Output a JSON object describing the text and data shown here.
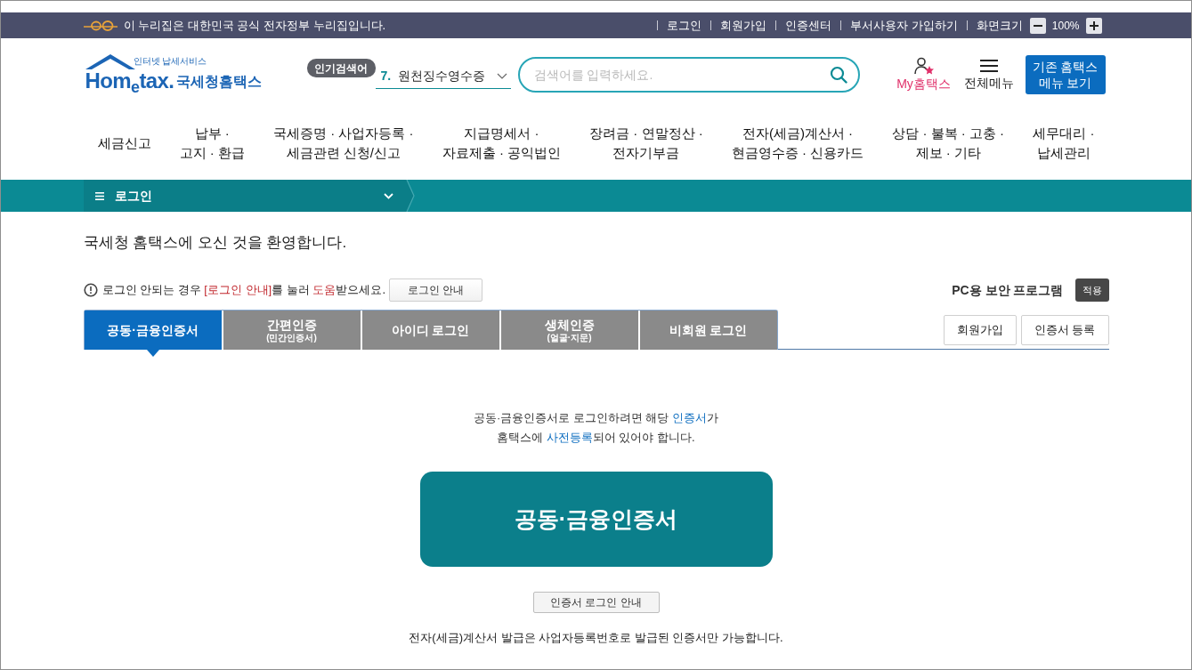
{
  "top_bar": {
    "notice": "이 누리집은 대한민국 공식 전자정부 누리집입니다.",
    "links": [
      "로그인",
      "회원가입",
      "인증센터",
      "부서사용자 가입하기"
    ],
    "zoom_label": "화면크기",
    "zoom_value": "100%"
  },
  "header": {
    "logo": {
      "tagline": "인터넷 납세서비스",
      "wordmark": "Hom$_{e}$tax.",
      "name": "국세청홈택스"
    },
    "popular_search": {
      "badge": "인기검색어",
      "rank": "7.",
      "term": "원천징수영수증"
    },
    "search": {
      "placeholder": "검색어를 입력하세요."
    },
    "my_hometax": "My홈택스",
    "all_menu": "전체메뉴",
    "classic_menu_button": [
      "기존 홈택스",
      "메뉴 보기"
    ]
  },
  "nav": [
    {
      "lines": [
        "세금신고"
      ]
    },
    {
      "lines": [
        "납부 ·",
        "고지 · 환급"
      ]
    },
    {
      "lines": [
        "국세증명 · 사업자등록 ·",
        "세금관련 신청/신고"
      ]
    },
    {
      "lines": [
        "지급명세서 ·",
        "자료제출 · 공익법인"
      ]
    },
    {
      "lines": [
        "장려금 · 연말정산 ·",
        "전자기부금"
      ]
    },
    {
      "lines": [
        "전자(세금)계산서 ·",
        "현금영수증 · 신용카드"
      ]
    },
    {
      "lines": [
        "상담 · 불복 · 고충 ·",
        "제보 · 기타"
      ]
    },
    {
      "lines": [
        "세무대리 ·",
        "납세관리"
      ]
    }
  ],
  "location_bar": {
    "current": "로그인"
  },
  "login": {
    "welcome": "국세청 홈택스에 오신 것을 환영합니다.",
    "help": [
      {
        "text": "로그인 안되는 경우 ",
        "emphasis": false
      },
      {
        "text": "[로그인 안내]",
        "emphasis": true
      },
      {
        "text": "를 눌러 ",
        "emphasis": false
      },
      {
        "text": "도움",
        "emphasis": true
      },
      {
        "text": "받으세요.",
        "emphasis": false
      }
    ],
    "help_button": "로그인 안내",
    "security_label": "PC용 보안 프로그램",
    "security_button": "적용",
    "tabs": [
      {
        "label": "공동·금융인증서",
        "selected": true
      },
      {
        "label": "간편인증",
        "sublabel": "(민간인증서)",
        "selected": false
      },
      {
        "label": "아이디 로그인",
        "selected": false
      },
      {
        "label": "생체인증",
        "sublabel": "(얼굴·지문)",
        "selected": false
      },
      {
        "label": "비회원 로그인",
        "selected": false
      }
    ],
    "side_buttons": [
      "회원가입",
      "인증서 등록"
    ],
    "notice": [
      [
        {
          "text": "공동·금융인증서로 로그인하려면 해당 ",
          "emphasis": false
        },
        {
          "text": "인증서",
          "emphasis": true
        },
        {
          "text": "가",
          "emphasis": false
        }
      ],
      [
        {
          "text": "홈택스에 ",
          "emphasis": false
        },
        {
          "text": "사전등록",
          "emphasis": true
        },
        {
          "text": "되어 있어야 합니다.",
          "emphasis": false
        }
      ]
    ],
    "main_button": "공동·금융인증서",
    "guide_button": "인증서 로그인 안내",
    "footnote": "전자(세금)계산서 발급은 사업자등록번호로 발급된 인증서만 가능합니다."
  }
}
